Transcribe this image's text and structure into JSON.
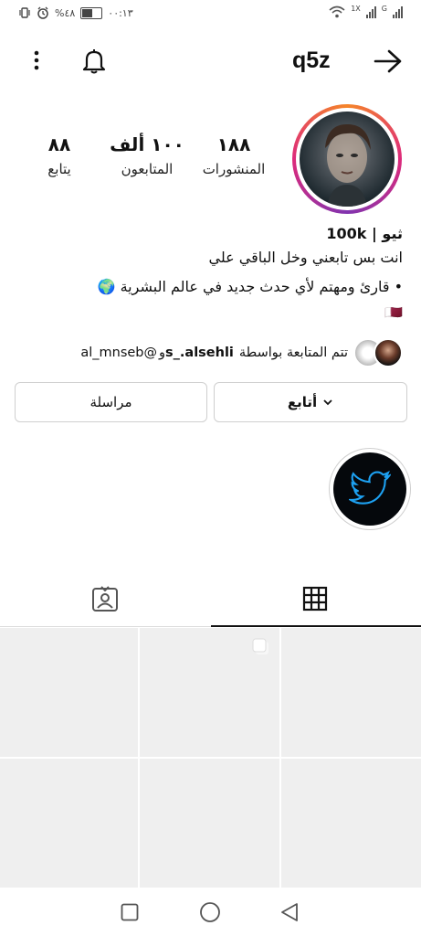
{
  "status_bar": {
    "time": "٠٠:١٣",
    "battery": "٤٨%",
    "battery_level": 0.48,
    "network_1": "1X",
    "network_2": "G"
  },
  "header": {
    "username": "q5z",
    "icons": {
      "back": "arrow-right-icon",
      "notifications": "bell-icon",
      "menu": "kebab-menu-icon"
    }
  },
  "stats": {
    "posts": {
      "value": "١٨٨",
      "label": "المنشورات"
    },
    "followers": {
      "value": "١٠٠ ألف",
      "label": "المتابعون"
    },
    "following": {
      "value": "٨٨",
      "label": "يتابع"
    }
  },
  "bio": {
    "name": "ثيو | 100k",
    "line1": "انت بس تابعني وخل الباقي علي",
    "line2": "• قارئ ومهتم لأي حدث جديد في عالم البشرية 🌍",
    "line3": "🇶🇦"
  },
  "followed_by": {
    "prefix": "تتم المتابعة بواسطة",
    "user1": "s_.alsehli",
    "connector": "و",
    "user2": "al_mnseb@"
  },
  "buttons": {
    "follow": "أتابع",
    "message": "مراسلة"
  },
  "tabs": {
    "grid": "grid-icon",
    "tagged": "tagged-icon"
  },
  "colors": {
    "accent": "#1da1f2",
    "divider": "#dbdbdb",
    "placeholder": "#efefef"
  }
}
